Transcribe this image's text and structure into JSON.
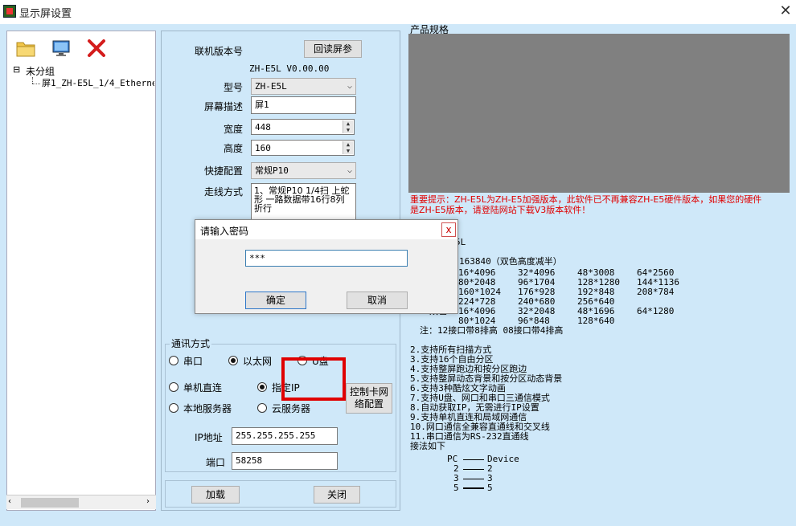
{
  "window": {
    "title": "显示屏设置",
    "close_glyph": "✕"
  },
  "toolbar": {
    "folder_icon": "folder-icon",
    "monitor_icon": "monitor-icon",
    "delete_icon": "delete-x-icon"
  },
  "tree": {
    "expander": "⊟",
    "root": "未分组",
    "child": "屏1_ZH-E5L_1/4_Etherne"
  },
  "form": {
    "version_label": "联机版本号",
    "readback_button": "回读屏参",
    "version_value": "ZH-E5L V0.00.00",
    "model_label": "型号",
    "model_value": "ZH-E5L",
    "desc_label": "屏幕描述",
    "desc_value": "屏1",
    "width_label": "宽度",
    "width_value": "448",
    "height_label": "高度",
    "height_value": "160",
    "quick_label": "快捷配置",
    "quick_value": "常规P10",
    "wiring_label": "走线方式",
    "wiring_value": "1、常规P10  1/4扫 上蛇形 一路数据带16行8列折行"
  },
  "comm": {
    "group_label": "通讯方式",
    "serial": "串口",
    "ethernet": "以太网",
    "usb": "U盘",
    "direct": "单机直连",
    "specify_ip": "指定IP",
    "local_server": "本地服务器",
    "cloud_server": "云服务器",
    "net_config_button": "控制卡网络配置",
    "ip_label": "IP地址",
    "ip_value": "255.255.255.255",
    "port_label": "端口",
    "port_value": "58258",
    "selected": "ethernet",
    "mode_selected": "specify_ip"
  },
  "footer": {
    "load_button": "加载",
    "close_button": "关闭"
  },
  "spec": {
    "header": "产品规格",
    "warning_line1": "重要提示：ZH-E5L为ZH-E5加强版本，此软件已不再兼容ZH-E5硬件版本，如果您的硬件",
    "warning_line2": "是ZH-E5版本，请登陆网站下载V3版本软件！",
    "model_suffix": "5L",
    "points": "：163840（双色高度减半）",
    "table": [
      [
        "16*4096",
        "32*4096",
        "48*3008",
        "64*2560"
      ],
      [
        "80*2048",
        "96*1704",
        "128*1280",
        "144*1136"
      ],
      [
        "160*1024",
        "176*928",
        "192*848",
        "208*784"
      ],
      [
        "224*728",
        "240*680",
        "256*640",
        ""
      ],
      [
        "16*4096",
        "32*2048",
        "48*1696",
        "64*1280"
      ],
      [
        "80*1024",
        "96*848",
        "128*640",
        ""
      ]
    ],
    "row_label": "双色",
    "note": "注：12接口带8排高  08接口带4排高",
    "features": [
      "2.支持所有扫描方式",
      "3.支持16个自由分区",
      "4.支持整屏跑边和按分区跑边",
      "5.支持整屏动态背景和按分区动态背景",
      "6.支持3种酷炫文字动画",
      "7.支持U盘、网口和串口三通信模式",
      "8.自动获取IP，无需进行IP设置",
      "9.支持单机直连和局域网通信",
      "10.网口通信全兼容直通线和交叉线",
      "11.串口通信为RS-232直通线",
      "   接法如下"
    ],
    "pin_header_left": "PC",
    "pin_header_right": "Device",
    "pins": [
      [
        "2",
        "2"
      ],
      [
        "3",
        "3"
      ],
      [
        "5",
        "5"
      ]
    ]
  },
  "dialog": {
    "title": "请输入密码",
    "close_glyph": "x",
    "password_value": "***",
    "ok_button": "确定",
    "cancel_button": "取消"
  },
  "colors": {
    "client_bg": "#cfe8f9",
    "warning": "#e00000",
    "highlight_box": "#e00000",
    "preview": "#808080"
  }
}
